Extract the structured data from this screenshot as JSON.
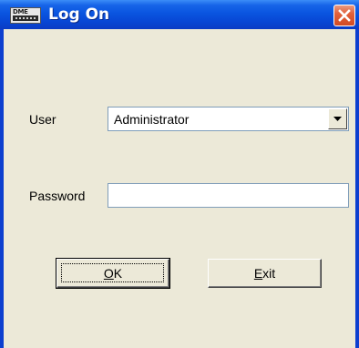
{
  "window": {
    "title": "Log On",
    "icon": "dme-app-icon",
    "icon_text": "DME",
    "close_icon": "close-icon"
  },
  "form": {
    "user_label": "User",
    "user_value": "Administrator",
    "user_dropdown_icon": "chevron-down-icon",
    "password_label": "Password",
    "password_value": ""
  },
  "buttons": {
    "ok_mnemonic": "O",
    "ok_rest": "K",
    "exit_mnemonic": "E",
    "exit_rest": "xit"
  },
  "colors": {
    "titlebar": "#0a55e0",
    "client_bg": "#ece9d8",
    "close_button": "#d24b23"
  }
}
